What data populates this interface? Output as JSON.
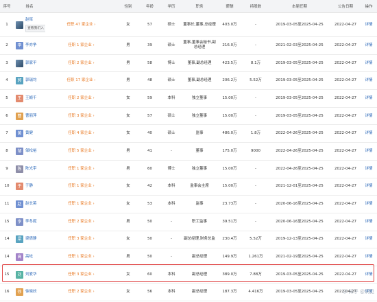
{
  "columns": [
    "序号",
    "姓名",
    "",
    "性别",
    "年龄",
    "学历",
    "职务",
    "薪酬",
    "持股数",
    "本届任期",
    "公告日期",
    "操作"
  ],
  "tag_label": "查看我们入",
  "rows": [
    {
      "no": "1",
      "avatar": "",
      "name": "赵晖",
      "tenure": "任职 47 家企业 ›",
      "gender": "女",
      "age": "57",
      "edu": "硕士",
      "title": "董事长,董事,总经理",
      "salary": "403.0万",
      "shares": "-",
      "term": "2019-03-05至2025-04-25",
      "date": "2022-04-27",
      "op": "详情"
    },
    {
      "no": "2",
      "avatar": "李",
      "name": "李亦争",
      "tenure": "任职 1 家企业 ›",
      "gender": "男",
      "age": "39",
      "edu": "硕士",
      "title": "董事,董事会秘书,副总经理",
      "salary": "216.0万",
      "shares": "-",
      "term": "2021-02-03至2025-04-25",
      "date": "2022-04-27",
      "op": "详情"
    },
    {
      "no": "3",
      "avatar": "",
      "name": "郭家平",
      "tenure": "任职 2 家企业 ›",
      "gender": "男",
      "age": "58",
      "edu": "博士",
      "title": "董事,副总经理",
      "salary": "423.5万",
      "shares": "8.1万",
      "term": "2019-03-05至2025-04-25",
      "date": "2022-04-27",
      "op": "详情"
    },
    {
      "no": "4",
      "avatar": "郭",
      "name": "郭瑞均",
      "tenure": "任职 17 家企业 ›",
      "gender": "男",
      "age": "48",
      "edu": "硕士",
      "title": "董事,副总经理",
      "salary": "206.2万",
      "shares": "5.52万",
      "term": "2019-03-05至2025-04-25",
      "date": "2022-04-27",
      "op": "详情"
    },
    {
      "no": "5",
      "avatar": "王",
      "name": "王颖千",
      "tenure": "任职 2 家企业 ›",
      "gender": "女",
      "age": "59",
      "edu": "本科",
      "title": "独立董事",
      "salary": "15.00万",
      "shares": "-",
      "term": "2019-03-05至2025-04-25",
      "date": "2022-04-27",
      "op": "详情"
    },
    {
      "no": "6",
      "avatar": "曹",
      "name": "曹丽萍",
      "tenure": "任职 3 家企业 ›",
      "gender": "女",
      "age": "57",
      "edu": "硕士",
      "title": "独立董事",
      "salary": "15.00万",
      "shares": "-",
      "term": "2019-03-05至2025-04-25",
      "date": "2022-04-27",
      "op": "详情"
    },
    {
      "no": "7",
      "avatar": "黄",
      "name": "黄健",
      "tenure": "任职 4 家企业 ›",
      "gender": "女",
      "age": "40",
      "edu": "硕士",
      "title": "监事",
      "salary": "486.0万",
      "shares": "1.8万",
      "term": "2022-04-26至2025-04-25",
      "date": "2022-04-27",
      "op": "详情"
    },
    {
      "no": "8",
      "avatar": "邹",
      "name": "邹松裕",
      "tenure": "任职 5 家企业 ›",
      "gender": "男",
      "age": "41",
      "edu": "-",
      "title": "董事",
      "salary": "175.0万",
      "shares": "9000",
      "term": "2022-04-26至2025-04-25",
      "date": "2022-04-27",
      "op": "详情"
    },
    {
      "no": "9",
      "avatar": "陈",
      "name": "陈光宇",
      "tenure": "任职 1 家企业 ›",
      "gender": "男",
      "age": "60",
      "edu": "博士",
      "title": "独立董事",
      "salary": "15.00万",
      "shares": "-",
      "term": "2022-04-26至2025-04-25",
      "date": "2022-04-27",
      "op": "详情"
    },
    {
      "no": "10",
      "avatar": "于",
      "name": "于静",
      "tenure": "任职 1 家企业 ›",
      "gender": "女",
      "age": "42",
      "edu": "本科",
      "title": "监事会主席",
      "salary": "15.00万",
      "shares": "-",
      "term": "2021-12-01至2025-04-25",
      "date": "2022-04-27",
      "op": "详情"
    },
    {
      "no": "11",
      "avatar": "赵",
      "name": "赵长英",
      "tenure": "任职 1 家企业 ›",
      "gender": "女",
      "age": "53",
      "edu": "本科",
      "title": "监事",
      "salary": "23.73万",
      "shares": "-",
      "term": "2020-06-16至2025-04-25",
      "date": "2022-04-27",
      "op": "详情"
    },
    {
      "no": "15",
      "avatar": "李",
      "name": "李冬妮",
      "tenure": "任职 2 家企业 ›",
      "gender": "男",
      "age": "50",
      "edu": "-",
      "title": "职工监事",
      "salary": "39.51万",
      "shares": "-",
      "term": "2020-06-16至2025-04-25",
      "date": "2022-04-27",
      "op": "详情"
    },
    {
      "no": "14",
      "avatar": "梁",
      "name": "梁倩静",
      "tenure": "任职 3 家企业 ›",
      "gender": "女",
      "age": "50",
      "edu": "-",
      "title": "副总经理,财务总监",
      "salary": "230.4万",
      "shares": "5.52万",
      "term": "2019-12-13至2025-04-25",
      "date": "2022-04-27",
      "op": "详情"
    },
    {
      "no": "14",
      "avatar": "高",
      "name": "高屹",
      "tenure": "任职 1 家企业 ›",
      "gender": "男",
      "age": "50",
      "edu": "-",
      "title": "副总经理",
      "salary": "149.9万",
      "shares": "1.261万",
      "term": "2021-02-19至2025-04-25",
      "date": "2022-04-27",
      "op": "详情"
    },
    {
      "no": "15",
      "avatar": "刘",
      "name": "刘爱华",
      "tenure": "任职 3 家企业 ›",
      "gender": "女",
      "age": "60",
      "edu": "本科",
      "title": "副总经理",
      "salary": "389.0万",
      "shares": "7.88万",
      "term": "2019-03-05至2025-04-25",
      "date": "2022-04-27",
      "op": "详情"
    },
    {
      "no": "16",
      "avatar": "徐",
      "name": "徐晓欣",
      "tenure": "任职 2 家企业 ›",
      "gender": "女",
      "age": "56",
      "edu": "本科",
      "title": "副总经理",
      "salary": "187.3万",
      "shares": "4.416万",
      "term": "2019-03-05至2025-04-25",
      "date": "2022-04-27",
      "op": "详情"
    }
  ],
  "avatar_colors": [
    "",
    "#6f8fd1",
    "",
    "#58a3c0",
    "#e38a6e",
    "#e1a150",
    "#6f8fd1",
    "#7d8fc7",
    "#8e8ea8",
    "#e38a6e",
    "#6f8fd1",
    "#7d8fc7",
    "#58a3c0",
    "#a384c9",
    "#56b2a3",
    "#e1a150"
  ],
  "watermark": "☺ 知乎 @洞见"
}
